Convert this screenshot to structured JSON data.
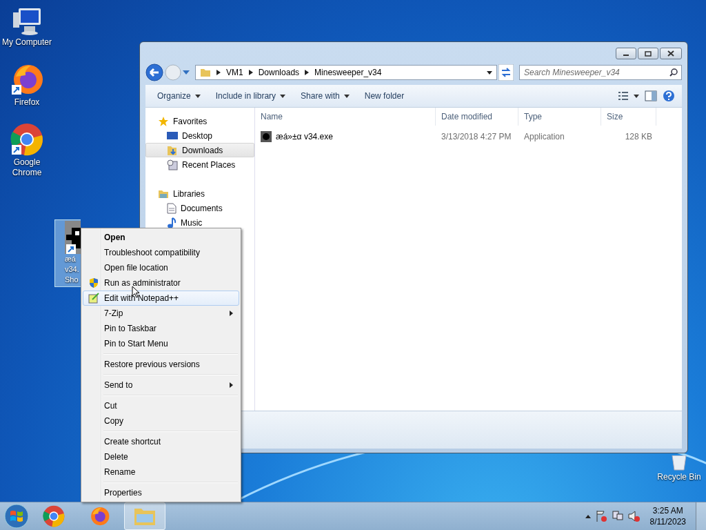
{
  "desktop_icons": [
    {
      "label": "My Computer",
      "kind": "computer"
    },
    {
      "label": "Firefox",
      "kind": "firefox"
    },
    {
      "label": "Google Chrome",
      "kind": "chrome"
    }
  ],
  "selected_shortcut": {
    "lines": [
      "æá",
      "v34.",
      "Sho"
    ],
    "selected": true
  },
  "recycle_bin": {
    "label": "Recycle Bin"
  },
  "explorer": {
    "address": [
      "VM1",
      "Downloads",
      "Minesweeper_v34"
    ],
    "search": {
      "placeholder": "Search Minesweeper_v34"
    },
    "toolbar": [
      {
        "label": "Organize",
        "dropdown": true
      },
      {
        "label": "Include in library",
        "dropdown": true
      },
      {
        "label": "Share with",
        "dropdown": true
      },
      {
        "label": "New folder",
        "dropdown": false
      }
    ],
    "nav": [
      {
        "label": "Favorites",
        "kind": "star",
        "children": [
          {
            "label": "Desktop",
            "kind": "desktop",
            "selected": false
          },
          {
            "label": "Downloads",
            "kind": "downloads",
            "selected": true
          },
          {
            "label": "Recent Places",
            "kind": "recent",
            "selected": false
          }
        ]
      },
      {
        "label": "Libraries",
        "kind": "libraries",
        "children": [
          {
            "label": "Documents",
            "kind": "documents",
            "selected": false
          },
          {
            "label": "Music",
            "kind": "music",
            "selected": false
          }
        ]
      }
    ],
    "columns": [
      "Name",
      "Date modified",
      "Type",
      "Size"
    ],
    "files": [
      {
        "name": "æá»±α v34.exe",
        "date": "3/13/2018 4:27 PM",
        "type": "Application",
        "size": "128 KB",
        "selected": false
      }
    ]
  },
  "context_menu": [
    {
      "kind": "bold",
      "label": "Open",
      "selected": false
    },
    {
      "kind": "plain",
      "label": "Troubleshoot compatibility",
      "selected": false
    },
    {
      "kind": "plain",
      "label": "Open file location",
      "selected": false
    },
    {
      "kind": "shield",
      "label": "Run as administrator",
      "selected": false
    },
    {
      "kind": "notepad",
      "label": "Edit with Notepad++",
      "selected": true
    },
    {
      "kind": "submenu",
      "label": "7-Zip",
      "selected": false
    },
    {
      "kind": "plain",
      "label": "Pin to Taskbar",
      "selected": false
    },
    {
      "kind": "plain",
      "label": "Pin to Start Menu",
      "selected": false
    },
    {
      "kind": "separator"
    },
    {
      "kind": "plain",
      "label": "Restore previous versions",
      "selected": false
    },
    {
      "kind": "separator"
    },
    {
      "kind": "submenu",
      "label": "Send to",
      "selected": false
    },
    {
      "kind": "separator"
    },
    {
      "kind": "plain",
      "label": "Cut",
      "selected": false
    },
    {
      "kind": "plain",
      "label": "Copy",
      "selected": false
    },
    {
      "kind": "separator"
    },
    {
      "kind": "plain",
      "label": "Create shortcut",
      "selected": false
    },
    {
      "kind": "plain",
      "label": "Delete",
      "selected": false
    },
    {
      "kind": "plain",
      "label": "Rename",
      "selected": false
    },
    {
      "kind": "separator"
    },
    {
      "kind": "plain",
      "label": "Properties",
      "selected": false
    }
  ],
  "taskbar": {
    "apps": [
      {
        "kind": "chrome",
        "active": false
      },
      {
        "kind": "firefox",
        "active": false
      },
      {
        "kind": "explorer",
        "active": true
      }
    ],
    "clock": {
      "time": "3:25 AM",
      "date": "8/11/2023"
    }
  }
}
